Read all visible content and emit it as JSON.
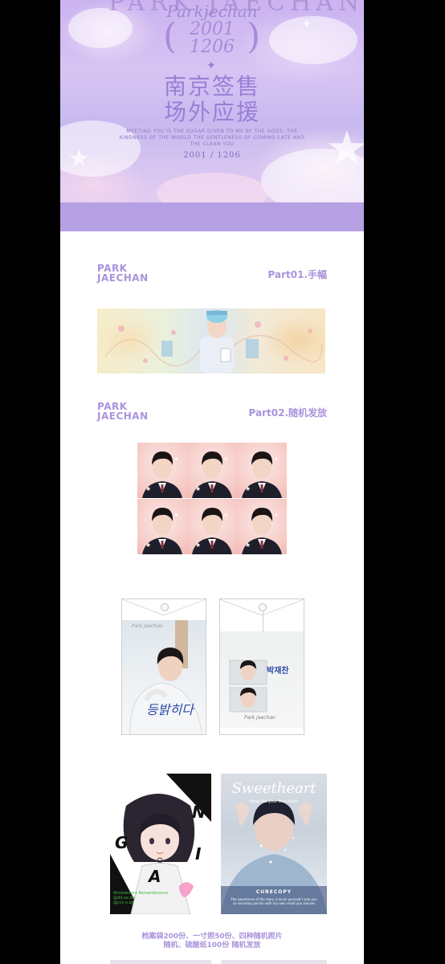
{
  "banner": {
    "top_word": "PARK JAECHAN",
    "script_name": "Parkjechan",
    "year_top": "2001",
    "year_bottom": "1206",
    "paren_left": "(",
    "paren_right": ")",
    "title_line1": "南京签售",
    "title_line2": "场外应援",
    "tagline": "MEETING YOU IS THE SUGAR GIVEN TO ME BY THE GODS. THE KINDNESS OF THE WORLD THE GENTLENESS OF COMING LATE AND THE CLEAN YOU",
    "date": "2001 / 1206"
  },
  "sections": [
    {
      "brand_line1": "PARK",
      "brand_line2": "JAECHAN",
      "part_label": "Part01.手幅"
    },
    {
      "brand_line1": "PARK",
      "brand_line2": "JAECHAN",
      "part_label": "Part02.随机发放"
    }
  ],
  "envelope_right": {
    "hangul_name": "박재찬",
    "signature": "Park Jaechan"
  },
  "envelope_left": {
    "signature": "Park Jaechan",
    "hangul_text": "등밝히다"
  },
  "card_left": {
    "letters": [
      "A",
      "N",
      "G",
      "I",
      "A"
    ],
    "note_line1": "Anniversary Remembrance",
    "note_line2": "@dd.xx.dd",
    "note_line3": "@ccc-x.zg"
  },
  "card_right": {
    "title": "Sweetheart",
    "subtitle": "show me your true heart",
    "caption_title": "CURECOPY",
    "caption_body": "The sweetness of the story is to be yourself I saw you so sincerely person with my own small you sincere"
  },
  "bottom_caption": {
    "line1": "档案袋200份、一寸照50份、四种随机照片",
    "line2": "随机、硫酸纸100份 随机发放"
  },
  "colors": {
    "page_bg": "#000000",
    "lilac": "#b6a0e4",
    "accent_text": "#a994dc"
  }
}
